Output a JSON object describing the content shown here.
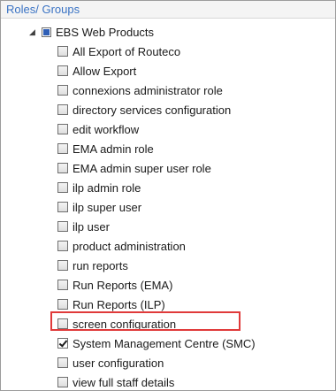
{
  "panel": {
    "title": "Roles/ Groups"
  },
  "tree": {
    "root": {
      "label": "EBS Web Products",
      "state": "partial"
    },
    "items": [
      {
        "label": "All Export of Routeco",
        "checked": false
      },
      {
        "label": "Allow Export",
        "checked": false
      },
      {
        "label": "connexions administrator role",
        "checked": false
      },
      {
        "label": "directory services configuration",
        "checked": false
      },
      {
        "label": "edit workflow",
        "checked": false
      },
      {
        "label": "EMA admin role",
        "checked": false
      },
      {
        "label": "EMA admin super user role",
        "checked": false
      },
      {
        "label": "ilp admin role",
        "checked": false
      },
      {
        "label": "ilp super user",
        "checked": false
      },
      {
        "label": "ilp user",
        "checked": false
      },
      {
        "label": "product administration",
        "checked": false
      },
      {
        "label": "run reports",
        "checked": false
      },
      {
        "label": "Run Reports (EMA)",
        "checked": false
      },
      {
        "label": "Run Reports (ILP)",
        "checked": false
      },
      {
        "label": "screen configuration",
        "checked": false
      },
      {
        "label": "System Management Centre (SMC)",
        "checked": true,
        "highlighted": true
      },
      {
        "label": "user configuration",
        "checked": false
      },
      {
        "label": "view full staff details",
        "checked": false
      }
    ]
  },
  "colors": {
    "header_text": "#3a73c4",
    "highlight_border": "#e03a3a"
  }
}
